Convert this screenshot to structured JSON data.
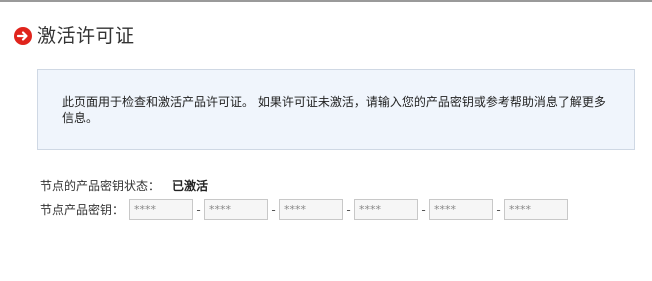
{
  "header": {
    "title": "激活许可证",
    "icon": "arrow-right-circle-icon",
    "icon_color": "#e0241c"
  },
  "info": {
    "message": "此页面用于检查和激活产品许可证。 如果许可证未激活，请输入您的产品密钥或参考帮助消息了解更多信息。"
  },
  "status": {
    "label": "节点的产品密钥状态：",
    "value": "已激活"
  },
  "product_key": {
    "label": "节点产品密钥：",
    "separator": "-",
    "segments": [
      {
        "placeholder": "****"
      },
      {
        "placeholder": "****"
      },
      {
        "placeholder": "****"
      },
      {
        "placeholder": "****"
      },
      {
        "placeholder": "****"
      },
      {
        "placeholder": "****"
      }
    ]
  }
}
